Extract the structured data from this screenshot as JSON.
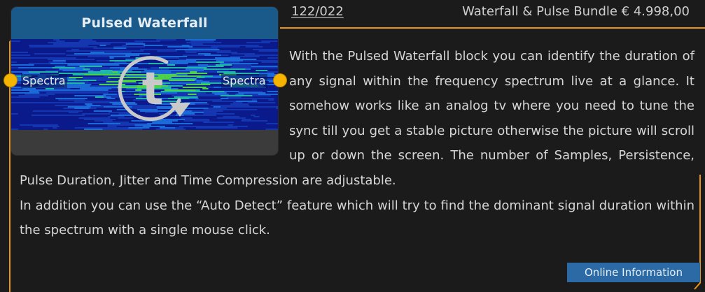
{
  "block": {
    "title": "Pulsed Waterfall",
    "input_label": "Spectra",
    "output_label": "Spectra",
    "icon": "time-t-icon",
    "port_color": "#f4b400",
    "title_bar_color": "#1a5a8a"
  },
  "header": {
    "part_number": "122/022",
    "bundle": "Waterfall & Pulse Bundle € 4.998,00"
  },
  "description": {
    "paragraph1": "With the Pulsed Waterfall block you can identify the duration of any signal within the frequency spectrum live at a glance. It somehow works like an analog tv where you need to tune the sync till you get a stable picture otherwise the picture will scroll up or down the screen. The number of Samples, Persistence, Pulse Duration, Jitter and Time Compression are adjustable.",
    "paragraph2": "In addition you can use the “Auto Detect” feature which will try to find the dominant signal duration within the spectrum with a single mouse click."
  },
  "actions": {
    "online_info_label": "Online Information"
  },
  "colors": {
    "accent_orange": "#e89418",
    "info_button": "#2b6aa5"
  }
}
